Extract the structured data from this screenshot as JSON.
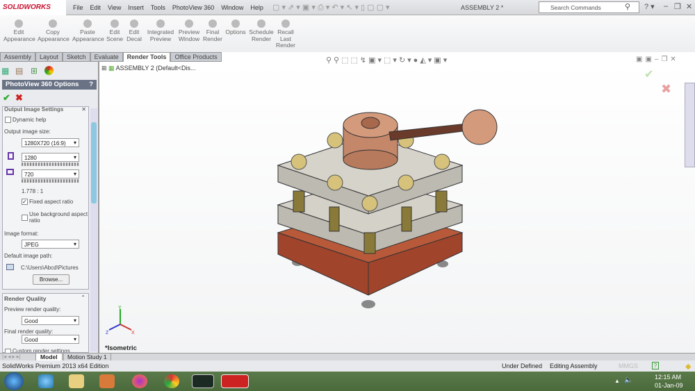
{
  "app": {
    "logo": "SOLIDWORKS",
    "doc_title": "ASSEMBLY 2 *"
  },
  "menu": [
    "File",
    "Edit",
    "View",
    "Insert",
    "Tools",
    "PhotoView 360",
    "Window",
    "Help"
  ],
  "search": {
    "placeholder": "Search Commands"
  },
  "toolbar": [
    "Edit Appearance",
    "Copy Appearance",
    "Paste Appearance",
    "Edit Scene",
    "Edit Decal",
    "Integrated Preview",
    "Preview Window",
    "Final Render",
    "Options",
    "Schedule Render",
    "Recall Last Render"
  ],
  "tabs": [
    "Assembly",
    "Layout",
    "Sketch",
    "Evaluate",
    "Render Tools",
    "Office Products"
  ],
  "panel": {
    "title": "PhotoView 360 Options",
    "help": "?",
    "output_group": "Output Image Settings",
    "dynamic_help": "Dynamic help",
    "output_size_label": "Output image size:",
    "output_size": "1280X720   (16:9)",
    "width": "1280",
    "height": "720",
    "ratio": "1.778 : 1",
    "fixed_aspect": "Fixed aspect ratio",
    "fixed_aspect_checked": true,
    "bg_aspect": "Use background aspect ratio",
    "format_label": "Image format:",
    "format": "JPEG",
    "path_label": "Default image path:",
    "path": "C:\\Users\\Abcd\\Pictures",
    "browse": "Browse...",
    "quality_group": "Render Quality",
    "preview_label": "Preview render quality:",
    "preview": "Good",
    "final_label": "Final render quality:",
    "final": "Good",
    "custom": "Custom render settings"
  },
  "tree": {
    "root": "ASSEMBLY 2  (Default<Dis..."
  },
  "view": {
    "orientation": "*Isometric",
    "axes": {
      "x": "X",
      "y": "Y",
      "z": "Z"
    }
  },
  "bottom_tabs": [
    "Model",
    "Motion Study 1"
  ],
  "status": {
    "edition": "SolidWorks Premium 2013 x64 Edition",
    "defined": "Under Defined",
    "mode": "Editing Assembly",
    "units": "MMGS"
  },
  "taskbar": {
    "time": "12:15 AM",
    "date": "01-Jan-09"
  }
}
